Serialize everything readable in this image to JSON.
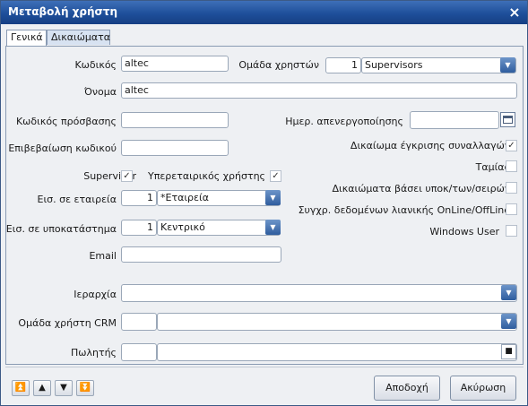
{
  "window": {
    "title": "Μεταβολή χρήστη",
    "close_symbol": "×"
  },
  "tabs": [
    {
      "label": "Γενικά"
    },
    {
      "label": "Δικαιώματα"
    }
  ],
  "form": {
    "code_label": "Κωδικός",
    "code_value": "altec",
    "group_label": "Ομάδα χρηστών",
    "group_num": "1",
    "group_name": "Supervisors",
    "name_label": "Όνομα",
    "name_value": "altec",
    "password_label": "Κωδικός πρόσβασης",
    "deactivation_label": "Ημερ. απενεργοποίησης",
    "confirm_label": "Επιβεβαίωση κωδικού",
    "approval_label": "Δικαίωμα έγκρισης συναλλαγών",
    "approval_checked": true,
    "supervisor_label": "Supervisor",
    "supervisor_checked": true,
    "service_label": "Υπερεταιρικός χρήστης",
    "service_checked": true,
    "cashier_label": "Ταμίας",
    "cashier_checked": false,
    "company_label": "Εισ. σε εταιρεία",
    "company_num": "1",
    "company_name": "*Εταιρεία",
    "rights_label": "Δικαιώματα βάσει υποκ/των/σειρών",
    "rights_checked": false,
    "sync_label": "Συγχρ. δεδομένων λιανικής OnLine/OffLine",
    "sync_checked": false,
    "branch_label": "Εισ. σε υποκατάστημα",
    "branch_num": "1",
    "branch_name": "Κεντρικό",
    "windows_user_label": "Windows User",
    "windows_user_checked": false,
    "email_label": "Email",
    "hierarchy_label": "Ιεραρχία",
    "crm_label": "Ομάδα χρήστη CRM",
    "seller_label": "Πωλητής"
  },
  "buttons": {
    "ok": "Αποδοχή",
    "cancel": "Ακύρωση"
  },
  "nav": {
    "first": "⏫",
    "prev": "▲",
    "next": "▼",
    "last": "⏬"
  },
  "icons": {
    "dropdown": "▼",
    "check": "✓",
    "square": "■"
  }
}
